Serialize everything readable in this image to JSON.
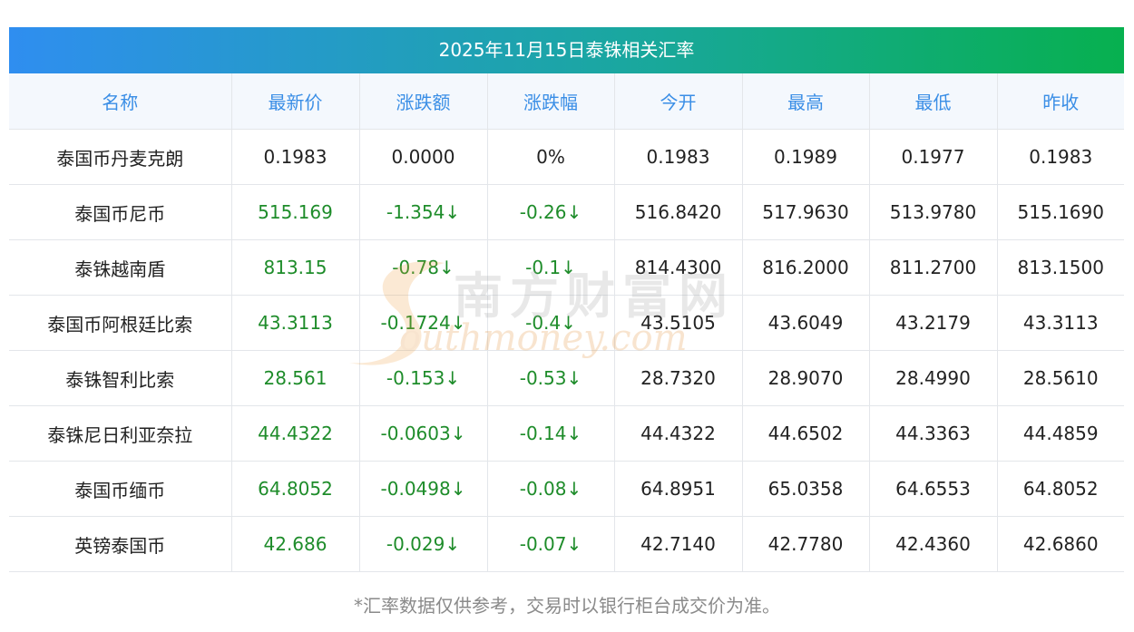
{
  "title": "2025年11月15日泰铢相关汇率",
  "columns": [
    "名称",
    "最新价",
    "涨跌额",
    "涨跌幅",
    "今开",
    "最高",
    "最低",
    "昨收"
  ],
  "rows": [
    [
      "泰国币丹麦克朗",
      "0.1983",
      "0.0000",
      "0%",
      "0.1983",
      "0.1989",
      "0.1977",
      "0.1983"
    ],
    [
      "泰国币尼币",
      "515.169",
      "-1.354↓",
      "-0.26↓",
      "516.8420",
      "517.9630",
      "513.9780",
      "515.1690"
    ],
    [
      "泰铢越南盾",
      "813.15",
      "-0.78↓",
      "-0.1↓",
      "814.4300",
      "816.2000",
      "811.2700",
      "813.1500"
    ],
    [
      "泰国币阿根廷比索",
      "43.3113",
      "-0.1724↓",
      "-0.4↓",
      "43.5105",
      "43.6049",
      "43.2179",
      "43.3113"
    ],
    [
      "泰铢智利比索",
      "28.561",
      "-0.153↓",
      "-0.53↓",
      "28.7320",
      "28.9070",
      "28.4990",
      "28.5610"
    ],
    [
      "泰铢尼日利亚奈拉",
      "44.4322",
      "-0.0603↓",
      "-0.14↓",
      "44.4322",
      "44.6502",
      "44.3363",
      "44.4859"
    ],
    [
      "泰国币缅币",
      "64.8052",
      "-0.0498↓",
      "-0.08↓",
      "64.8951",
      "65.0358",
      "64.6553",
      "64.8052"
    ],
    [
      "英镑泰国币",
      "42.686",
      "-0.029↓",
      "-0.07↓",
      "42.7140",
      "42.7780",
      "42.4360",
      "42.6860"
    ]
  ],
  "footnote": "*汇率数据仅供参考，交易时以银行柜台成交价为准。",
  "watermark": {
    "cn": "南方财富网",
    "en": "outhmoney.com"
  },
  "colors": {
    "header_text": "#3a8ee6",
    "change_text": "#1e8c2a",
    "title_start": "#2f8ef0",
    "title_end": "#07b04f"
  }
}
